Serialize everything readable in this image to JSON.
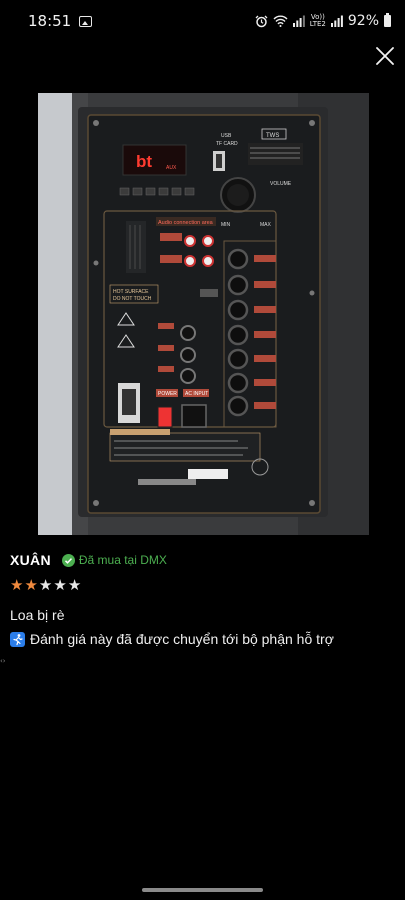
{
  "status_bar": {
    "time": "18:51",
    "network_top": "Vo))",
    "network_bottom": "LTE2",
    "battery": "92%"
  },
  "photo": {
    "display": "bt",
    "display_small": "AUX",
    "top_badge": "TWS",
    "usb_label": "USB",
    "card_label": "TF CARD",
    "volume_label": "VOLUME",
    "min_label": "MIN",
    "max_label": "MAX",
    "audio_area_label": "Audio connection area",
    "hot_line1": "HOT SURFACE",
    "hot_line2": "DO NOT TOUCH",
    "power_label": "POWER",
    "ac_label": "AC INPUT"
  },
  "review": {
    "reviewer": "XUÂN",
    "verified": "Đã mua tại DMX",
    "rating": 2,
    "max_rating": 5,
    "text": "Loa bị rè",
    "support_note": "Đánh giá này đã được chuyển tới bộ phận hỗ trợ",
    "side_arrows": "‹›"
  },
  "colors": {
    "star_on": "#f08a3e",
    "star_off": "#e8e8e8",
    "verified": "#4caf50",
    "accent_icon": "#2b7de9"
  },
  "icons": {
    "close": "close-icon",
    "verified": "check-circle-icon",
    "support": "person-running-icon"
  }
}
